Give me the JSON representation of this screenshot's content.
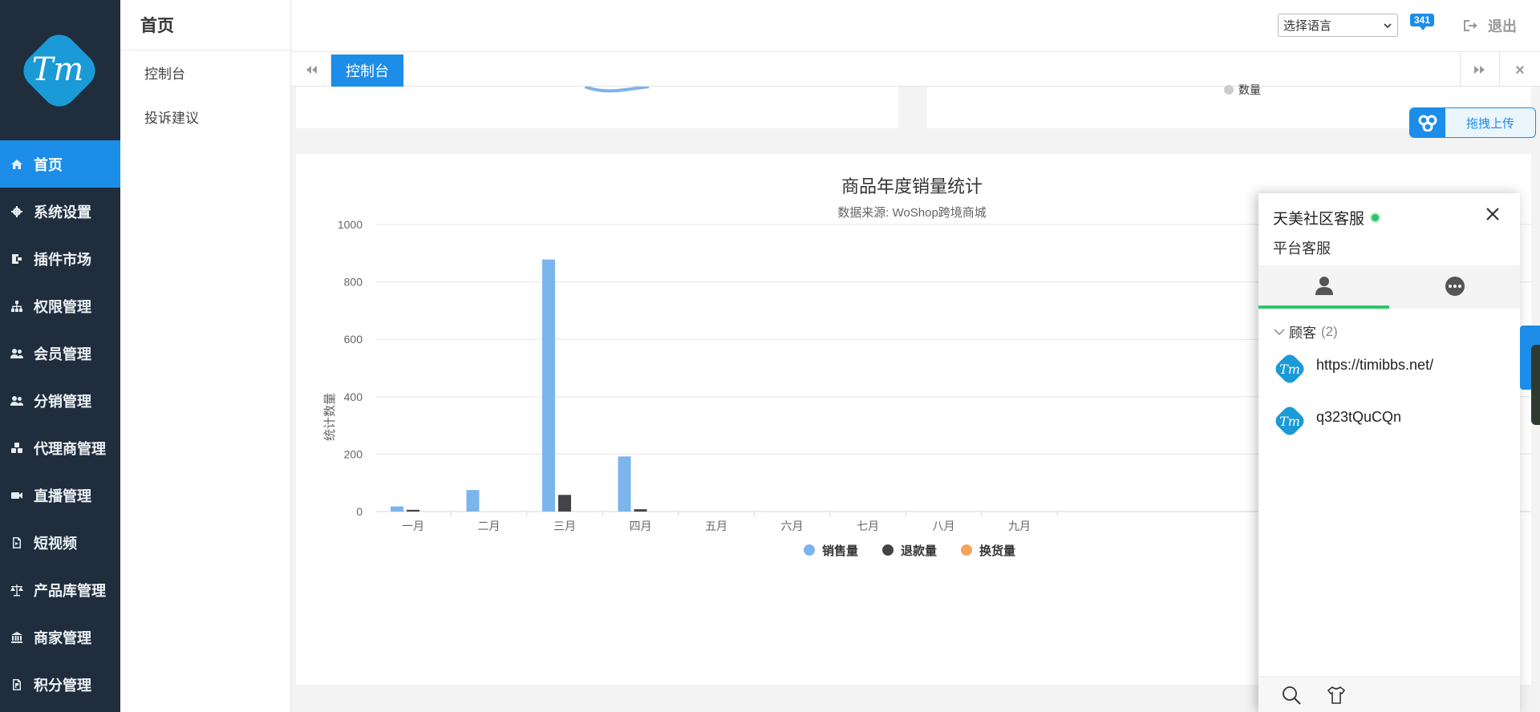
{
  "sidebar": {
    "items": [
      {
        "label": "首页",
        "icon": "home-icon",
        "active": true
      },
      {
        "label": "系统设置",
        "icon": "gear-icon"
      },
      {
        "label": "插件市场",
        "icon": "plugin-icon"
      },
      {
        "label": "权限管理",
        "icon": "sitemap-icon"
      },
      {
        "label": "会员管理",
        "icon": "users-icon"
      },
      {
        "label": "分销管理",
        "icon": "users-icon"
      },
      {
        "label": "代理商管理",
        "icon": "cubes-icon"
      },
      {
        "label": "直播管理",
        "icon": "video-camera-icon"
      },
      {
        "label": "短视频",
        "icon": "file-video-icon"
      },
      {
        "label": "产品库管理",
        "icon": "balance-scale-icon"
      },
      {
        "label": "商家管理",
        "icon": "bank-icon"
      },
      {
        "label": "积分管理",
        "icon": "file-points-icon"
      }
    ]
  },
  "submenu": {
    "title": "首页",
    "items": [
      "控制台",
      "投诉建议"
    ]
  },
  "header": {
    "language_select": "选择语言",
    "notification_count": "341",
    "logout_label": "退出"
  },
  "tabs": {
    "active_label": "控制台"
  },
  "upload": {
    "label": "拖拽上传"
  },
  "top_partial": {
    "legend_fragment": "数量"
  },
  "chart_data": {
    "type": "bar",
    "title": "商品年度销量统计",
    "subtitle": "数据来源: WoShop跨境商城",
    "ylabel": "统计数量",
    "ylim": [
      0,
      1000
    ],
    "yticks": [
      "1000",
      "800",
      "600",
      "400",
      "200",
      "0"
    ],
    "categories": [
      "一月",
      "二月",
      "三月",
      "四月",
      "五月",
      "六月",
      "七月",
      "八月",
      "九月"
    ],
    "series": [
      {
        "name": "销售量",
        "color": "#7cb5ec",
        "values": [
          18,
          75,
          878,
          192,
          0,
          0,
          0,
          0,
          0
        ]
      },
      {
        "name": "退款量",
        "color": "#434348",
        "values": [
          6,
          0,
          58,
          8,
          0,
          0,
          0,
          0,
          0
        ]
      },
      {
        "name": "换货量",
        "color": "#f7a35c",
        "values": [
          0,
          0,
          0,
          0,
          0,
          0,
          0,
          0,
          0
        ]
      }
    ],
    "grid": true,
    "legend_position": "bottom"
  },
  "chat": {
    "title": "天美社区客服",
    "subtitle": "平台客服",
    "group_label": "顾客",
    "group_count": "(2)",
    "contacts": [
      "https://timibbs.net/",
      "q323tQuCQn"
    ]
  },
  "colors": {
    "sidebar_bg": "#1f2d3d",
    "accent": "#1c8de8",
    "online": "#2ec46a"
  }
}
